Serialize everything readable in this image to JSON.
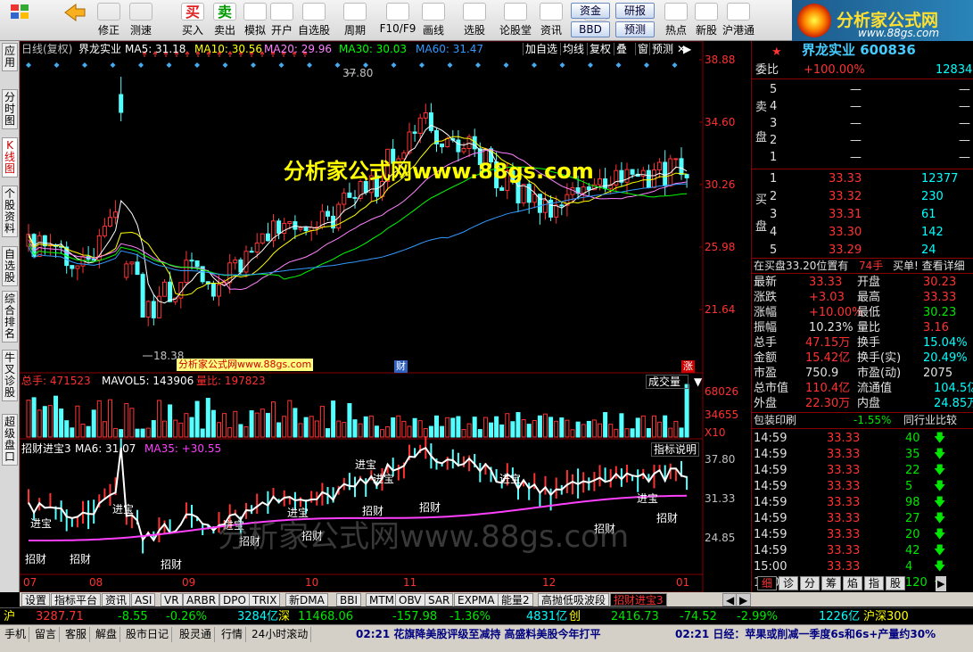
{
  "toolbar": {
    "items": [
      {
        "label": "",
        "icon": "windows-icon"
      },
      {
        "label": "",
        "icon": "back-arrow-icon"
      },
      {
        "label": "修正",
        "icon": "fix-icon"
      },
      {
        "label": "测速",
        "icon": "clock-icon"
      },
      {
        "label": "买入",
        "icon": "buy-icon",
        "glyph": "买"
      },
      {
        "label": "卖出",
        "icon": "sell-icon",
        "glyph": "卖"
      },
      {
        "label": "模拟",
        "icon": "hammer-icon"
      },
      {
        "label": "开户",
        "icon": "lock-icon"
      },
      {
        "label": "自选股",
        "icon": "star-icon"
      },
      {
        "label": "周期",
        "icon": "period-icon"
      },
      {
        "label": "F10/F9",
        "icon": "f10-icon"
      },
      {
        "label": "画线",
        "icon": "pen-icon"
      },
      {
        "label": "选股",
        "icon": "select-icon"
      },
      {
        "label": "论股堂",
        "icon": "forum-icon"
      },
      {
        "label": "资讯",
        "icon": "news-icon"
      },
      {
        "label": "数据",
        "icon": "data-icon"
      },
      {
        "label": "热点",
        "icon": "hot-icon"
      },
      {
        "label": "新股",
        "icon": "newstock-icon"
      },
      {
        "label": "沪港通",
        "icon": "hk-icon"
      }
    ],
    "small": [
      "资金",
      "研报",
      "BBD",
      "预测"
    ]
  },
  "logo": {
    "title": "分析家公式网",
    "url": "www.88gs.com"
  },
  "left_tabs": [
    "应用",
    "分时图",
    "K线图",
    "个股资料",
    "自选股",
    "综合排名",
    "牛叉诊股",
    "超级盘口"
  ],
  "kline": {
    "period": "日线(复权)",
    "stock": "界龙实业",
    "ma": [
      {
        "label": "MA5: 31.18",
        "color": "#ffffff"
      },
      {
        "label": "MA10: 30.56",
        "color": "#ffff00"
      },
      {
        "label": "MA20: 29.96",
        "color": "#ff80ff"
      },
      {
        "label": "MA30: 30.03",
        "color": "#00ff00"
      },
      {
        "label": "MA60: 31.47",
        "color": "#3399ff"
      }
    ],
    "buttons": [
      "加自选",
      "均线",
      "复权",
      "叠",
      "窗",
      "预测"
    ],
    "price_axis": [
      "38.88",
      "34.60",
      "30.26",
      "25.98",
      "21.64"
    ],
    "high_label": "37.80",
    "low_label": "18.38",
    "watermark": "分析家公式网www.88gs.com",
    "small_watermark": "分析家公式网www.88gs.com",
    "cai": "财",
    "zhang": "涨"
  },
  "volume": {
    "total": "总手: 471523",
    "mavol": "MAVOL5: 143906",
    "liangbi": "量比: 197823",
    "dropdown": "成交量",
    "axis": [
      "68026",
      "34655"
    ],
    "unit": "X10"
  },
  "indicator": {
    "name": "招财进宝3",
    "ma6": "MA6: 31.07",
    "ma35": "MA35: +30.55",
    "btn": "指标说明",
    "axis": [
      "37.80",
      "31.33",
      "24.85"
    ],
    "jinbao": "进宝",
    "zhaocai": "招财",
    "watermark": "分析家公式网www.88gs.com"
  },
  "xaxis": [
    "07",
    "08",
    "09",
    "10",
    "11",
    "12",
    "01"
  ],
  "right": {
    "title": "界龙实业 600836",
    "weibi_label": "委比",
    "weibi_val": "+100.00%",
    "weicha": "12834",
    "sell": [
      {
        "n": "5",
        "p": "—",
        "v": "—"
      },
      {
        "n": "4",
        "p": "—",
        "v": "—"
      },
      {
        "n": "3",
        "p": "—",
        "v": "—"
      },
      {
        "n": "2",
        "p": "—",
        "v": "—"
      },
      {
        "n": "1",
        "p": "—",
        "v": "—"
      }
    ],
    "buy": [
      {
        "n": "1",
        "p": "33.33",
        "v": "12377"
      },
      {
        "n": "2",
        "p": "33.32",
        "v": "230"
      },
      {
        "n": "3",
        "p": "33.31",
        "v": "61"
      },
      {
        "n": "4",
        "p": "33.30",
        "v": "142"
      },
      {
        "n": "5",
        "p": "33.29",
        "v": "24"
      }
    ],
    "sell_label": "卖盘",
    "buy_label": "买盘",
    "notice": "在买盘33.20位置有",
    "notice_hands": "74手",
    "notice_tail": "买单! 查看详细",
    "stats": [
      [
        "最新",
        "33.33",
        "开盘",
        "30.23"
      ],
      [
        "涨跌",
        "+3.03",
        "最高",
        "33.33"
      ],
      [
        "涨幅",
        "+10.00%",
        "最低",
        "30.23"
      ],
      [
        "振幅",
        "10.23%",
        "量比",
        "3.16"
      ],
      [
        "总手",
        "47.15万",
        "换手",
        "15.04%"
      ],
      [
        "金额",
        "15.42亿",
        "换手(实)",
        "20.49%"
      ],
      [
        "市盈",
        "750.9",
        "市盈(动)",
        "2075"
      ],
      [
        "总市值",
        "110.4亿",
        "流通值",
        "104.5亿"
      ],
      [
        "外盘",
        "22.30万",
        "内盘",
        "24.85万"
      ]
    ],
    "baozhuang": "包装印刷",
    "bz_pct": "-1.55%",
    "compare": "同行业比较",
    "ticks": [
      [
        "14:59",
        "33.33",
        "40"
      ],
      [
        "14:59",
        "33.33",
        "35"
      ],
      [
        "14:59",
        "33.33",
        "22"
      ],
      [
        "14:59",
        "33.33",
        "5"
      ],
      [
        "14:59",
        "33.33",
        "98"
      ],
      [
        "14:59",
        "33.33",
        "27"
      ],
      [
        "14:59",
        "33.33",
        "20"
      ],
      [
        "14:59",
        "33.33",
        "42"
      ],
      [
        "15:00",
        "33.33",
        "4"
      ],
      [
        "15:00",
        "33.33",
        "120"
      ]
    ],
    "rtabs": [
      "细",
      "诊",
      "分",
      "筹",
      "焰",
      "指",
      "股"
    ]
  },
  "bottom_tabs": [
    "设置",
    "指标平台",
    "资讯",
    "ASI",
    "VR",
    "ARBR",
    "DPO",
    "TRIX",
    "新DMA",
    "BBI",
    "MTM",
    "OBV",
    "SAR",
    "EXPMA",
    "能量2",
    "高抛低吸波段",
    "招财进宝3"
  ],
  "index_bar": {
    "sh": "沪",
    "sh_val": "3287.71",
    "sh_chg": "-8.55",
    "sh_pct": "-0.26%",
    "sh_amt": "3284亿",
    "sz": "深",
    "sz_val": "11468.06",
    "sz_chg": "-157.98",
    "sz_pct": "-1.36%",
    "sz_amt": "4831亿",
    "cy": "创",
    "cy_val": "2416.73",
    "cy_chg": "-74.52",
    "cy_pct": "-2.99%",
    "hs_amt": "1226亿",
    "hs": "沪深300"
  },
  "status": {
    "items": [
      "手机",
      "留言",
      "客服",
      "解盘",
      "股市日记",
      "股灵通",
      "行情",
      "24小时滚动"
    ],
    "news1": "02:21 花旗降美股评级至减持 高盛料美股今年打平",
    "news2": "02:21 日经：苹果或削减一季度6s和6s+产量约30%"
  }
}
